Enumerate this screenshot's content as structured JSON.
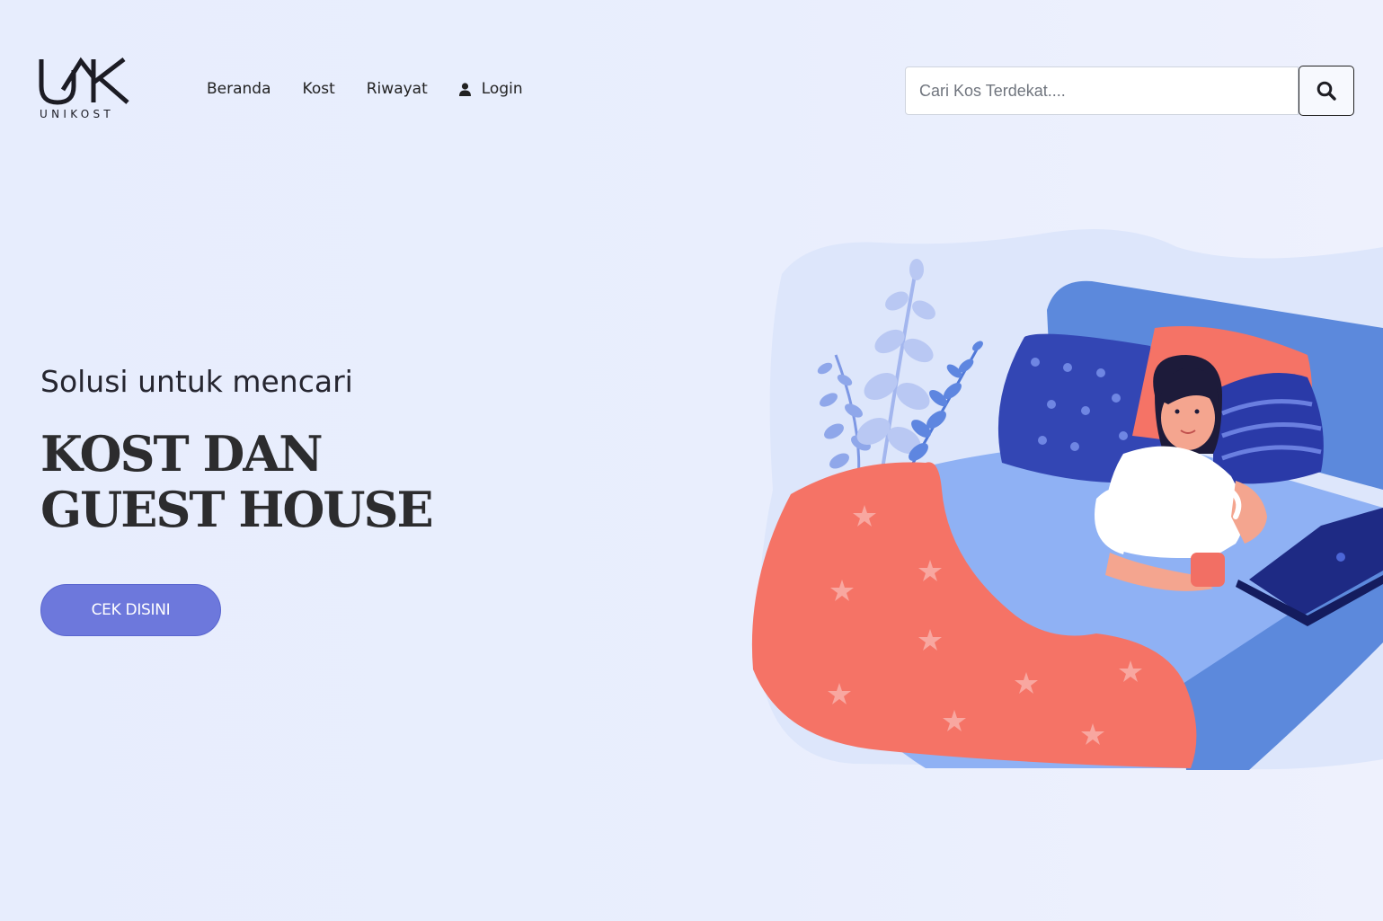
{
  "brand": {
    "logo_text": "UNIKOST"
  },
  "nav": {
    "items": [
      {
        "label": "Beranda"
      },
      {
        "label": "Kost"
      },
      {
        "label": "Riwayat"
      },
      {
        "label": "Login",
        "icon": "user-icon"
      }
    ]
  },
  "search": {
    "placeholder": "Cari Kos Terdekat....",
    "value": "",
    "icon": "search-icon"
  },
  "hero": {
    "subtitle": "Solusi untuk mencari",
    "title_line1": "KOST DAN",
    "title_line2": "GUEST HOUSE",
    "cta_label": "CEK DISINI"
  },
  "colors": {
    "background": "#e9eefd",
    "cta": "#6d78dc",
    "blanket": "#f57366",
    "bed": "#5b8bdf",
    "pillow_dark": "#3346b4",
    "text_dark": "#2c2c2e"
  }
}
